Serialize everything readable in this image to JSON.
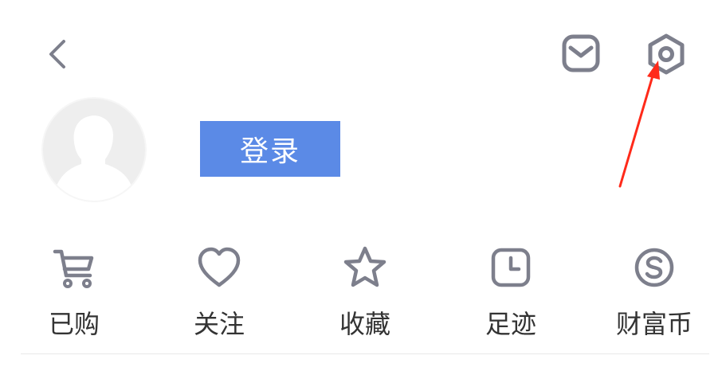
{
  "header": {
    "back_icon": "chevron-left-icon",
    "mail_icon": "mail-icon",
    "settings_icon": "hexagon-gear-icon"
  },
  "profile": {
    "avatar_icon": "person-silhouette-icon",
    "login_label": "登录"
  },
  "shortcuts": [
    {
      "label": "已购",
      "icon": "cart-icon"
    },
    {
      "label": "关注",
      "icon": "heart-icon"
    },
    {
      "label": "收藏",
      "icon": "star-icon"
    },
    {
      "label": "足迹",
      "icon": "clock-icon"
    },
    {
      "label": "财富币",
      "icon": "coin-icon"
    }
  ],
  "colors": {
    "accent": "#5b8ae6",
    "icon_gray": "#7d7f8c",
    "text": "#333333",
    "annotation_arrow": "#ff2a1a"
  }
}
